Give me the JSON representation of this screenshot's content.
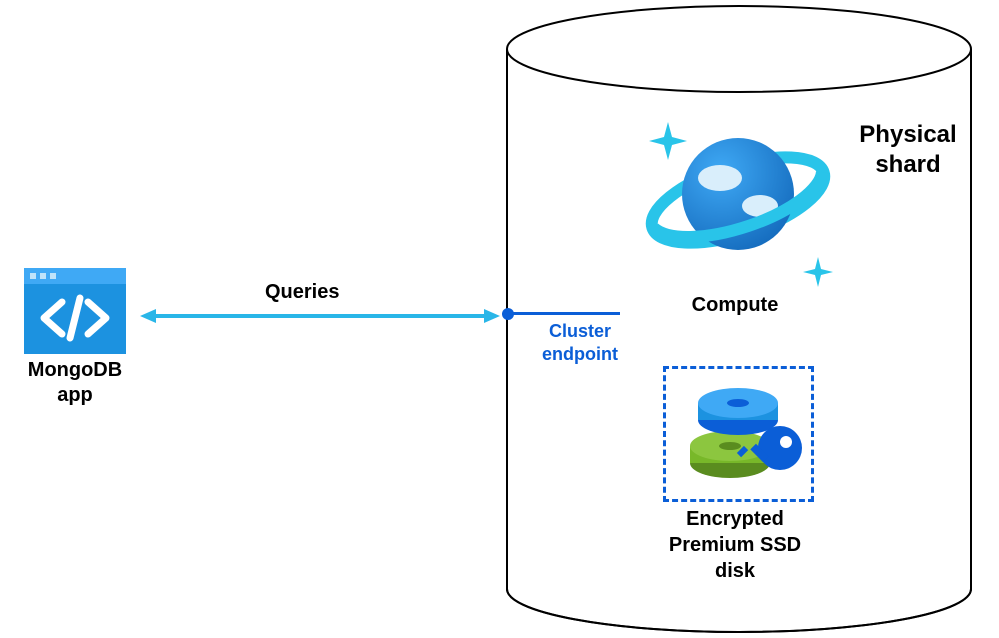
{
  "app": {
    "label": "MongoDB app"
  },
  "connection": {
    "label": "Queries",
    "endpoint_label": "Cluster endpoint"
  },
  "shard": {
    "label": "Physical shard",
    "compute_label": "Compute",
    "storage_label": "Encrypted Premium SSD disk"
  },
  "colors": {
    "azure_blue": "#1c92e0",
    "dark_blue": "#0b5ed7",
    "accent": "#29b6e8",
    "green": "#78b829"
  }
}
